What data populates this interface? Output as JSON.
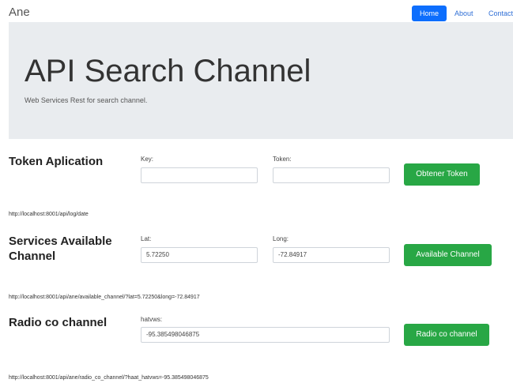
{
  "navbar": {
    "brand": "Ane",
    "links": [
      {
        "label": "Home"
      },
      {
        "label": "About"
      },
      {
        "label": "Contact"
      }
    ]
  },
  "hero": {
    "title": "API Search Channel",
    "lead": "Web Services Rest for search channel."
  },
  "token_section": {
    "title": "Token Aplication",
    "key_label": "Key:",
    "key_value": "",
    "token_label": "Token:",
    "token_value": "",
    "button": "Obtener Token",
    "url": "http://localhost:8001/api/log/date"
  },
  "services_section": {
    "title_line1": "Services Available",
    "title_line2": "Channel",
    "lat_label": "Lat:",
    "lat_value": "5.72250",
    "long_label": "Long:",
    "long_value": "-72.84917",
    "button": "Available Channel",
    "url": "http://localhost:8001/api/ane/available_channel/?lat=5.72250&long=-72.84917"
  },
  "radio_section": {
    "title": "Radio co channel",
    "hatvws_label": "hatvws:",
    "hatvws_value": "-95.385498046875",
    "button": "Radio co channel",
    "url": "http://localhost:8001/api/ane/radio_co_channel/?haat_hatvws=-95.385498046875"
  },
  "colors": {
    "primary": "#0d6efd",
    "success": "#28a745",
    "jumbotron_bg": "#e9ecef"
  }
}
